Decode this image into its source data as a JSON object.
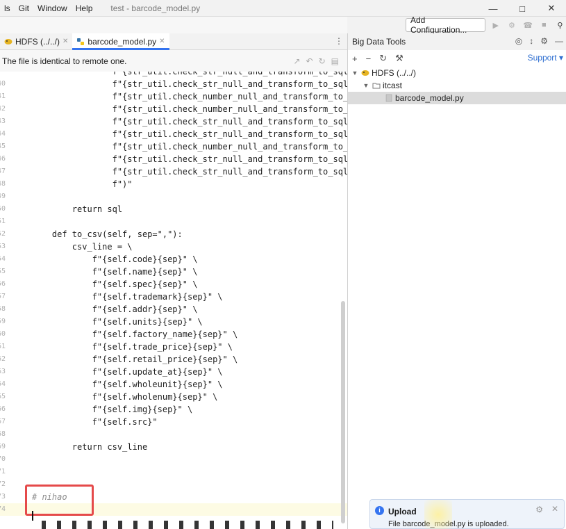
{
  "menubar": {
    "items": [
      "ls",
      "Git",
      "Window",
      "Help"
    ],
    "title": "test - barcode_model.py",
    "controls": [
      "—",
      "□",
      "✕"
    ]
  },
  "toolbar": {
    "config_label": "Add Configuration...",
    "icons": [
      "run-icon",
      "debug-icon",
      "coverage-icon",
      "stop-icon",
      "search-icon"
    ]
  },
  "editor_tabs": {
    "tabs": [
      {
        "label": "HDFS (../../)",
        "active": false
      },
      {
        "label": "barcode_model.py",
        "active": true
      }
    ]
  },
  "notice": {
    "text": "The file is identical to remote one."
  },
  "editor": {
    "lines": [
      {
        "n": "",
        "code": "                f\"{str_util.check_str_null_and_transform_to_sql_null(se"
      },
      {
        "n": "40",
        "code": "                f\"{str_util.check_str_null_and_transform_to_sql_null(se"
      },
      {
        "n": "41",
        "code": "                f\"{str_util.check_number_null_and_transform_to_sql_nul"
      },
      {
        "n": "42",
        "code": "                f\"{str_util.check_number_null_and_transform_to_sql_nul"
      },
      {
        "n": "43",
        "code": "                f\"{str_util.check_str_null_and_transform_to_sql_null(se"
      },
      {
        "n": "44",
        "code": "                f\"{str_util.check_str_null_and_transform_to_sql_null(se"
      },
      {
        "n": "45",
        "code": "                f\"{str_util.check_number_null_and_transform_to_sql_nul"
      },
      {
        "n": "46",
        "code": "                f\"{str_util.check_str_null_and_transform_to_sql_null(se"
      },
      {
        "n": "47",
        "code": "                f\"{str_util.check_str_null_and_transform_to_sql_null(se"
      },
      {
        "n": "48",
        "code": "                f\")\""
      },
      {
        "n": "49",
        "code": ""
      },
      {
        "n": "50",
        "code": "        return sql"
      },
      {
        "n": "51",
        "code": ""
      },
      {
        "n": "52",
        "code": "    def to_csv(self, sep=\",\"):"
      },
      {
        "n": "53",
        "code": "        csv_line = \\"
      },
      {
        "n": "54",
        "code": "            f\"{self.code}{sep}\" \\"
      },
      {
        "n": "55",
        "code": "            f\"{self.name}{sep}\" \\"
      },
      {
        "n": "56",
        "code": "            f\"{self.spec}{sep}\" \\"
      },
      {
        "n": "57",
        "code": "            f\"{self.trademark}{sep}\" \\"
      },
      {
        "n": "58",
        "code": "            f\"{self.addr}{sep}\" \\"
      },
      {
        "n": "59",
        "code": "            f\"{self.units}{sep}\" \\"
      },
      {
        "n": "60",
        "code": "            f\"{self.factory_name}{sep}\" \\"
      },
      {
        "n": "61",
        "code": "            f\"{self.trade_price}{sep}\" \\"
      },
      {
        "n": "62",
        "code": "            f\"{self.retail_price}{sep}\" \\"
      },
      {
        "n": "63",
        "code": "            f\"{self.update_at}{sep}\" \\"
      },
      {
        "n": "64",
        "code": "            f\"{self.wholeunit}{sep}\" \\"
      },
      {
        "n": "65",
        "code": "            f\"{self.wholenum}{sep}\" \\"
      },
      {
        "n": "66",
        "code": "            f\"{self.img}{sep}\" \\"
      },
      {
        "n": "67",
        "code": "            f\"{self.src}\""
      },
      {
        "n": "68",
        "code": ""
      },
      {
        "n": "69",
        "code": "        return csv_line"
      },
      {
        "n": "70",
        "code": ""
      },
      {
        "n": "71",
        "code": ""
      },
      {
        "n": "72",
        "code": ""
      },
      {
        "n": "73",
        "code": "# nihao"
      },
      {
        "n": "74",
        "code": ""
      }
    ]
  },
  "bdt": {
    "title": "Big Data Tools",
    "support_label": "Support",
    "tree": [
      {
        "label": "HDFS (../../)",
        "level": 0,
        "expanded": true,
        "icon": "hdfs-icon",
        "selected": false
      },
      {
        "label": "itcast",
        "level": 1,
        "expanded": true,
        "icon": "folder-icon",
        "selected": false
      },
      {
        "label": "barcode_model.py",
        "level": 2,
        "expanded": false,
        "icon": "file-icon",
        "selected": true
      }
    ]
  },
  "toast": {
    "title": "Upload",
    "message": "File barcode_model.py is uploaded."
  },
  "colors": {
    "accent": "#3574f0",
    "highlight_box": "#e54a4a"
  }
}
